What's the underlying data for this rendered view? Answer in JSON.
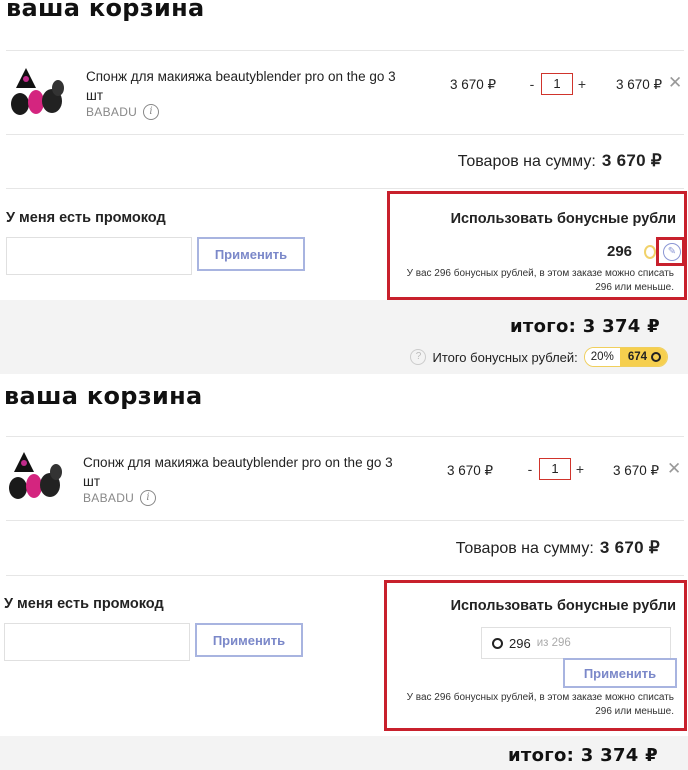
{
  "panel1": {
    "title": "ваша корзина",
    "item": {
      "name": "Спонж для макияжа beautyblender pro on the go 3 шт",
      "brand": "BABADU",
      "price": "3 670 ₽",
      "qty": "1",
      "line_total": "3 670 ₽"
    },
    "subtotal_label": "Товаров на сумму:",
    "subtotal_value": "3 670 ₽",
    "promo": {
      "label": "У меня есть промокод",
      "input_value": "",
      "apply_label": "Применить"
    },
    "bonus": {
      "title": "Использовать бонусные рубли",
      "amount": "296",
      "note": "У вас 296 бонусных рублей, в этом заказе можно списать 296 или меньше."
    },
    "total_label": "итого:",
    "total_value": "3 374 ₽",
    "bonus_total_label": "Итого бонусных рублей:",
    "bonus_pct": "20%",
    "bonus_total": "674"
  },
  "panel2": {
    "title": "ваша корзина",
    "item": {
      "name": "Спонж для макияжа beautyblender pro on the go 3 шт",
      "brand": "BABADU",
      "price": "3 670 ₽",
      "qty": "1",
      "line_total": "3 670 ₽"
    },
    "subtotal_label": "Товаров на сумму:",
    "subtotal_value": "3 670 ₽",
    "promo": {
      "label": "У меня есть промокод",
      "input_value": "",
      "apply_label": "Применить"
    },
    "bonus": {
      "title": "Использовать бонусные рубли",
      "input_value": "296",
      "input_of": "из 296",
      "apply_label": "Применить",
      "note": "У вас 296 бонусных рублей, в этом заказе можно списать 296 или меньше."
    },
    "total_label": "итого:",
    "total_value": "3 374 ₽"
  },
  "colors": {
    "highlight": "#c8202c",
    "accent": "#7b88c9",
    "bonus": "#f6cf4e"
  },
  "icons": [
    "product-thumbnail",
    "info-icon",
    "close-icon",
    "coin-icon",
    "edit-icon",
    "help-icon",
    "bonus-ring-icon"
  ]
}
